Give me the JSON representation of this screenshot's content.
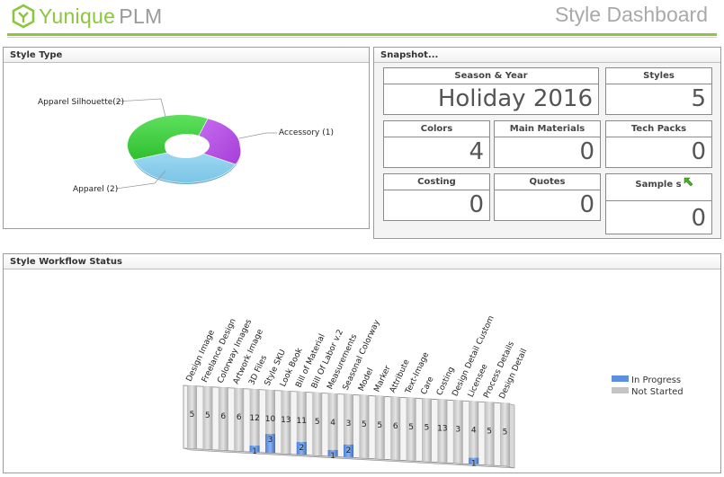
{
  "app": {
    "logo_main": "Yunique",
    "logo_suffix": "PLM",
    "page_title": "Style Dashboard"
  },
  "colors": {
    "brand_green": "#8cc63f",
    "in_progress": "#5b8fe0",
    "not_started": "#c4c4c4"
  },
  "style_type": {
    "title": "Style Type",
    "chart_data": {
      "type": "pie",
      "labels": [
        "Apparel Silhouette(2)",
        "Accessory (1)",
        "Apparel (2)"
      ],
      "values": [
        2,
        1,
        2
      ],
      "colors": [
        "#3fcf3f",
        "#b44fe0",
        "#87ceeb"
      ]
    }
  },
  "snapshot": {
    "title": "Snapshot...",
    "tiles": {
      "season": {
        "label": "Season & Year",
        "value": "Holiday 2016"
      },
      "styles": {
        "label": "Styles",
        "value": "5"
      },
      "colors": {
        "label": "Colors",
        "value": "4"
      },
      "materials": {
        "label": "Main Materials",
        "value": "0"
      },
      "techpacks": {
        "label": "Tech Packs",
        "value": "0"
      },
      "costing": {
        "label": "Costing",
        "value": "0"
      },
      "quotes": {
        "label": "Quotes",
        "value": "0"
      },
      "samples": {
        "label": "Sample s",
        "value": "0"
      }
    }
  },
  "workflow": {
    "title": "Style Workflow Status",
    "chart_data": {
      "type": "bar",
      "categories": [
        "Design Image",
        "Freelance Design",
        "Colorway Images",
        "Artwork Image",
        "3D Files",
        "Style SKU",
        "Look Book",
        "Bill of Material",
        "Bill Of Labor v.2",
        "Measurements",
        "Seasonal Colorway",
        "Model",
        "Marker",
        "Attribute",
        "Text-Image",
        "Care",
        "Costing",
        "Design Detail Custom",
        "Licensee",
        "Process Details",
        "Design Detail"
      ],
      "series": [
        {
          "name": "In Progress",
          "values": [
            0,
            0,
            0,
            0,
            1,
            3,
            0,
            2,
            0,
            1,
            2,
            0,
            0,
            0,
            0,
            0,
            0,
            0,
            1,
            0,
            0
          ]
        },
        {
          "name": "Not Started",
          "values": [
            5,
            5,
            6,
            6,
            12,
            10,
            13,
            11,
            5,
            4,
            3,
            5,
            5,
            6,
            5,
            5,
            13,
            3,
            4,
            5,
            5
          ]
        }
      ],
      "legend": "right"
    }
  }
}
